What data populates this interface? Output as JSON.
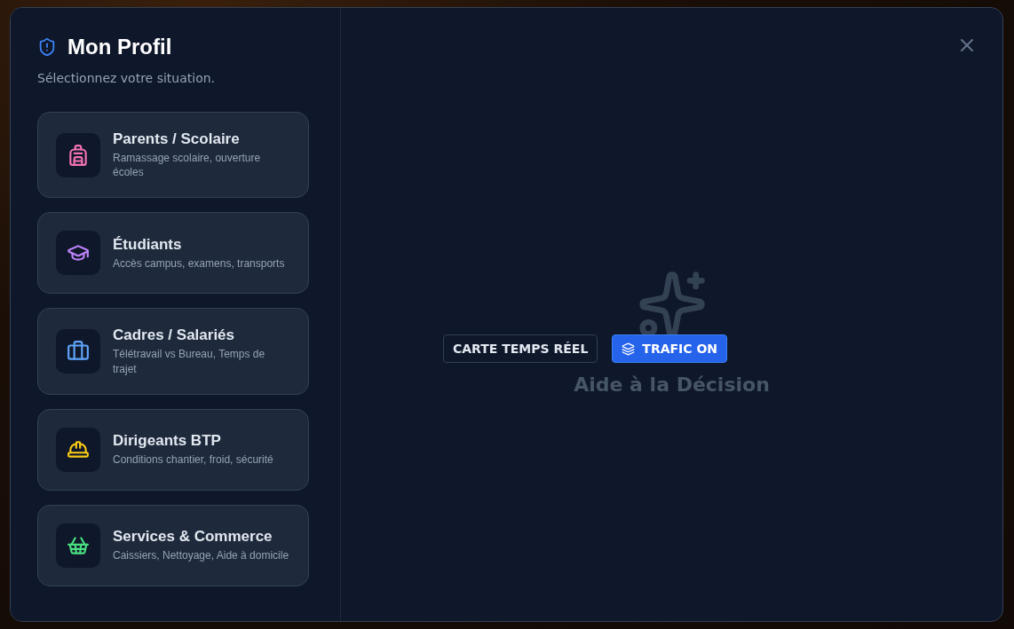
{
  "sidebar": {
    "title": "Mon Profil",
    "subtitle": "Sélectionnez votre situation.",
    "profiles": [
      {
        "kind": "backpack",
        "color": "#f472b6",
        "title": "Parents / Scolaire",
        "description": "Ramassage scolaire, ouverture écoles"
      },
      {
        "kind": "graduation",
        "color": "#c084fc",
        "title": "Étudiants",
        "description": "Accès campus, examens, transports"
      },
      {
        "kind": "briefcase",
        "color": "#60a5fa",
        "title": "Cadres / Salariés",
        "description": "Télétravail vs Bureau, Temps de trajet"
      },
      {
        "kind": "helmet",
        "color": "#facc15",
        "title": "Dirigeants BTP",
        "description": "Conditions chantier, froid, sécurité"
      },
      {
        "kind": "basket",
        "color": "#4ade80",
        "title": "Services & Commerce",
        "description": "Caissiers, Nettoyage, Aide à domicile"
      }
    ]
  },
  "main": {
    "placeholder_title": "Aide à la Décision",
    "map_buttons": [
      {
        "label": "CARTE TEMPS RÉEL",
        "selected": false
      },
      {
        "label": "TRAFIC ON",
        "selected": true
      }
    ]
  }
}
